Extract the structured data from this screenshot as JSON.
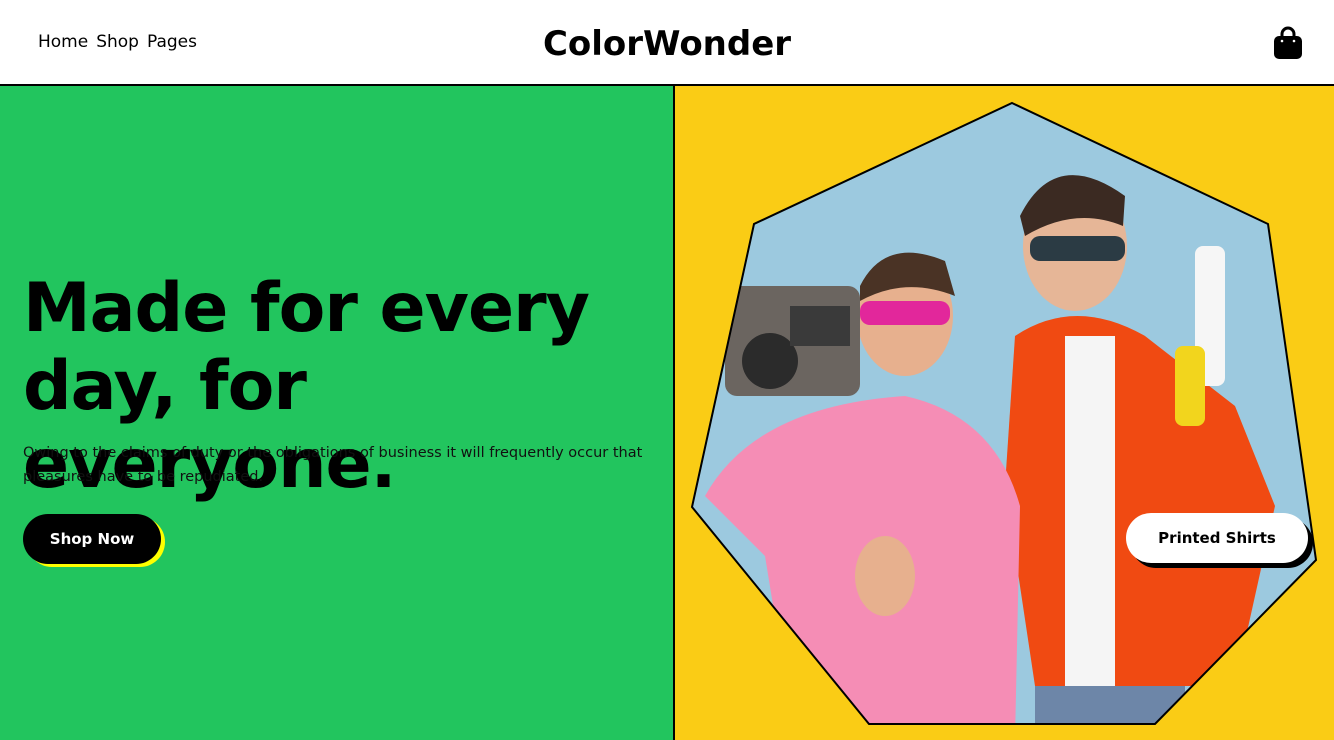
{
  "header": {
    "nav": [
      "Home",
      "Shop",
      "Pages"
    ],
    "logo": "ColorWonder",
    "cart_icon": "shopping-bag-icon"
  },
  "hero": {
    "title": "Made for every day, for everyone.",
    "description": "Owing to the claims of duty or the obligations of business it will frequently occur that pleasures have to be repudiated.",
    "cta": "Shop Now",
    "badge": "Printed Shirts"
  },
  "colors": {
    "green": "#22c55e",
    "yellow": "#facc15",
    "accent": "#ffff00"
  }
}
